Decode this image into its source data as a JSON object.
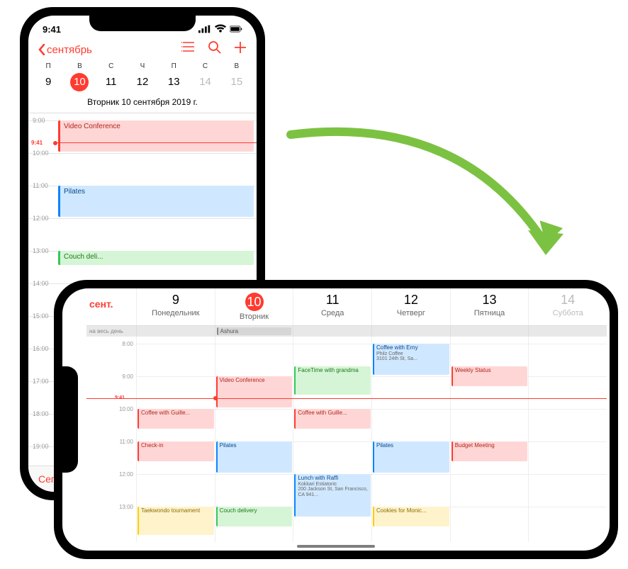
{
  "status": {
    "time": "9:41"
  },
  "portrait": {
    "nav": {
      "back": "сентябрь"
    },
    "week_abbr": [
      "П",
      "В",
      "С",
      "Ч",
      "П",
      "С",
      "В"
    ],
    "week_nums": [
      "9",
      "10",
      "11",
      "12",
      "13",
      "14",
      "15"
    ],
    "date_title": "Вторник  10 сентября 2019 г.",
    "hours": [
      "9:00",
      "10:00",
      "11:00",
      "12:00",
      "13:00",
      "14:00",
      "15:00",
      "16:00",
      "17:00",
      "18:00",
      "19:00"
    ],
    "now": "9:41",
    "events": {
      "video": "Video Conference",
      "pilates": "Pilates",
      "couch": "Couch deli..."
    },
    "today": "Сегод"
  },
  "landscape": {
    "month": "сент.",
    "days": [
      {
        "num": "9",
        "name": "Понедельник"
      },
      {
        "num": "10",
        "name": "Вторник"
      },
      {
        "num": "11",
        "name": "Среда"
      },
      {
        "num": "12",
        "name": "Четверг"
      },
      {
        "num": "13",
        "name": "Пятница"
      },
      {
        "num": "14",
        "name": "Суббота"
      }
    ],
    "allday": {
      "label": "на весь день",
      "ashura": "Ashura"
    },
    "hours": [
      "8:00",
      "9:00",
      "10:00",
      "11:00",
      "12:00",
      "13:00"
    ],
    "now": "9:41",
    "events": {
      "coffee_erny": "Coffee with Erny",
      "coffee_erny_sub1": "Philz Coffee",
      "coffee_erny_sub2": "3101 24th St, Sa...",
      "facetime": "FaceTime with grandma",
      "video": "Video Conference",
      "weekly": "Weekly Status",
      "coffee_guille1": "Coffee with Guille...",
      "coffee_guille2": "Coffee with Guille...",
      "checkin": "Check-in",
      "pilates1": "Pilates",
      "pilates2": "Pilates",
      "lunch": "Lunch with Raffi",
      "lunch_sub1": "Kokkari Estiatorio",
      "lunch_sub2": "200 Jackson St, San Francisco, CA   941...",
      "budget": "Budget Meeting",
      "taekwondo": "Taekwondo tournament",
      "couch": "Couch delivery",
      "cookies": "Cookies for Monic..."
    }
  }
}
